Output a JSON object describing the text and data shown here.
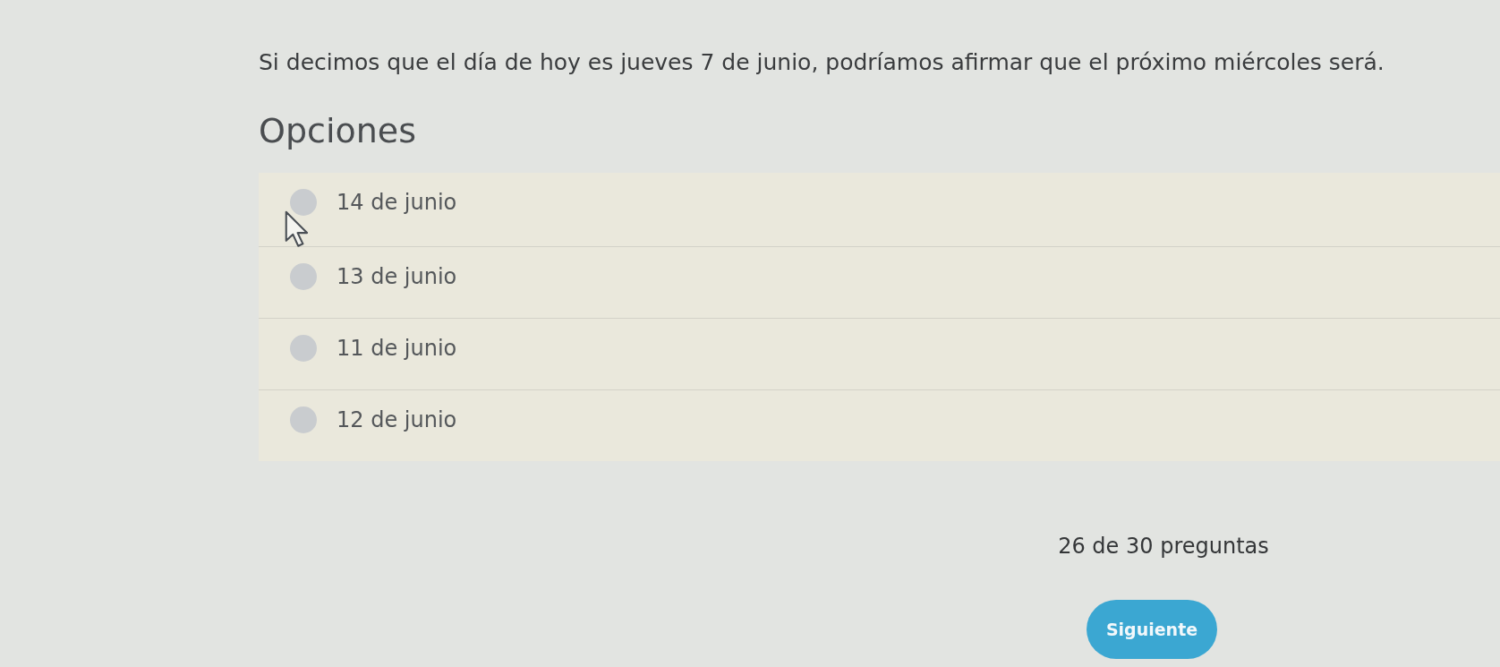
{
  "question": "Si decimos que el día de hoy es jueves 7 de junio, podríamos afirmar que el próximo miércoles será.",
  "options_heading": "Opciones",
  "options": [
    {
      "label": "14 de junio",
      "selected": false
    },
    {
      "label": "13 de junio",
      "selected": false
    },
    {
      "label": "11 de junio",
      "selected": false
    },
    {
      "label": "12 de junio",
      "selected": false
    }
  ],
  "progress": "26 de 30 preguntas",
  "next_button": "Siguiente"
}
